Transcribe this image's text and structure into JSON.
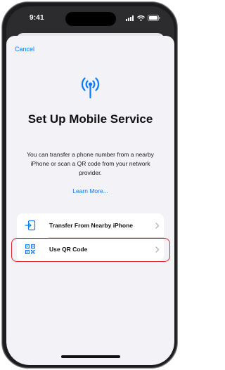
{
  "status_bar": {
    "time": "9:41"
  },
  "sheet": {
    "cancel_label": "Cancel",
    "icon": "cellular-antenna-icon",
    "title": "Set Up Mobile Service",
    "description": "You can transfer a phone number from a nearby iPhone or scan a QR code from your network provider.",
    "learn_more_label": "Learn More..."
  },
  "options": [
    {
      "label": "Transfer From Nearby iPhone",
      "icon": "transfer-icon"
    },
    {
      "label": "Use QR Code",
      "icon": "qr-code-icon"
    }
  ],
  "colors": {
    "accent": "#0a7aff",
    "highlight": "#e0212b",
    "sheet_background": "#f2f2f7"
  }
}
